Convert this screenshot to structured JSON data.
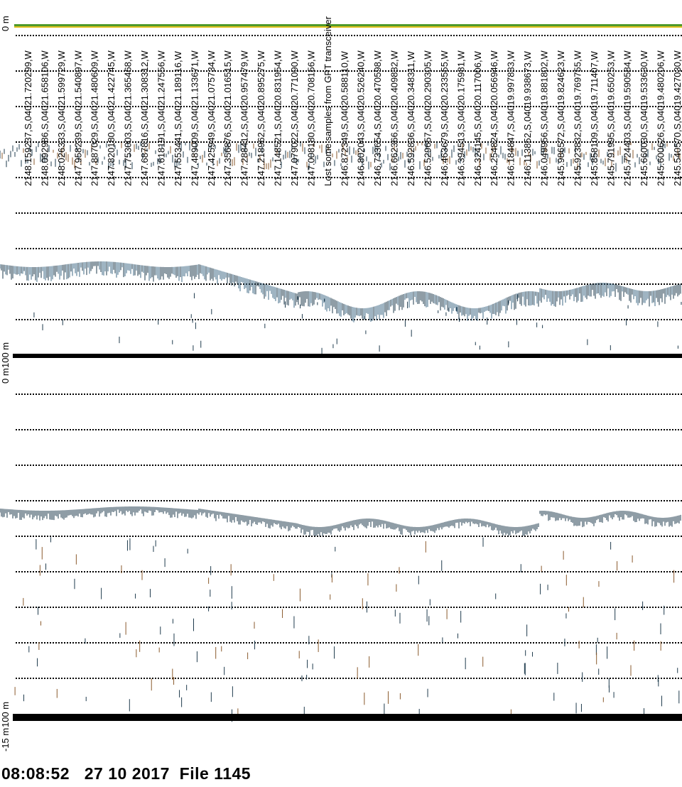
{
  "axis": {
    "top_panel_start": "0  m",
    "top_panel_end": "100  m",
    "bottom_panel_start": "0  m",
    "bottom_panel_end": "100  m",
    "bottom_panel_offset": "-15  m"
  },
  "status": {
    "time": "08:08:52",
    "date": "27 10 2017",
    "file": "File 1145"
  },
  "gps_labels": [
    "2148.159237,S,04021.720299,W",
    "2148.092986,S,04021.658106,W",
    "2148.026333,S,04021.599729,W",
    "2147.958239,S,04021.540897,W",
    "2147.887029,S,04021.480609,W",
    "2147.820180,S,04021.422745,W",
    "2147.753003,S,04021.365468,W",
    "2147.687816,S,04021.308312,W",
    "2147.618191,S,04021.247556,W",
    "2147.553441,S,04021.189116,W",
    "2147.489009,S,04021.133671,W",
    "2147.425949,S,04021.075734,W",
    "2147.356876,S,04021.016515,W",
    "2147.288412,S,04020.957479,W",
    "2147.218962,S,04020.895275,W",
    "2147.148521,S,04020.831954,W",
    "2147.079022,S,04020.771090,W",
    "2147.008180,S,04020.708156,W",
    "Lost some samples from GPT transceiver",
    "2146.872349,S,04020.588110,W",
    "2146.802043,S,04020.526240,W",
    "2146.733654,S,04020.470598,W",
    "2146.662366,S,04020.409832,W",
    "2146.592836,S,04020.348311,W",
    "2146.529657,S,04020.290305,W",
    "2146.463679,S,04020.233555,W",
    "2146.394513,S,04020.175981,W",
    "2146.324145,S,04020.117006,W",
    "2146.254824,S,04020.056946,W",
    "2146.184847,S,04019.997833,W",
    "2146.113852,S,04019.938673,W",
    "2146.049956,S,04019.881802,W",
    "2145.986572,S,04019.824623,W",
    "2145.923832,S,04019.769755,W",
    "2145.858109,S,04019.711407,W",
    "2145.791995,S,04019.650253,W",
    "2145.724403,S,04019.590584,W",
    "2145.660030,S,04019.533630,W",
    "2145.600626,S,04019.480206,W",
    "2145.540570,S,04019.427030,W"
  ],
  "colors": {
    "background": "#ffffff",
    "grid": "#000000",
    "echo_dark": "#1f3b4d",
    "echo_mid": "#3f6a86",
    "echo_warm": "#8a5a2c",
    "surface_green": "#4f9a2a",
    "surface_yellow": "#e0c020"
  }
}
